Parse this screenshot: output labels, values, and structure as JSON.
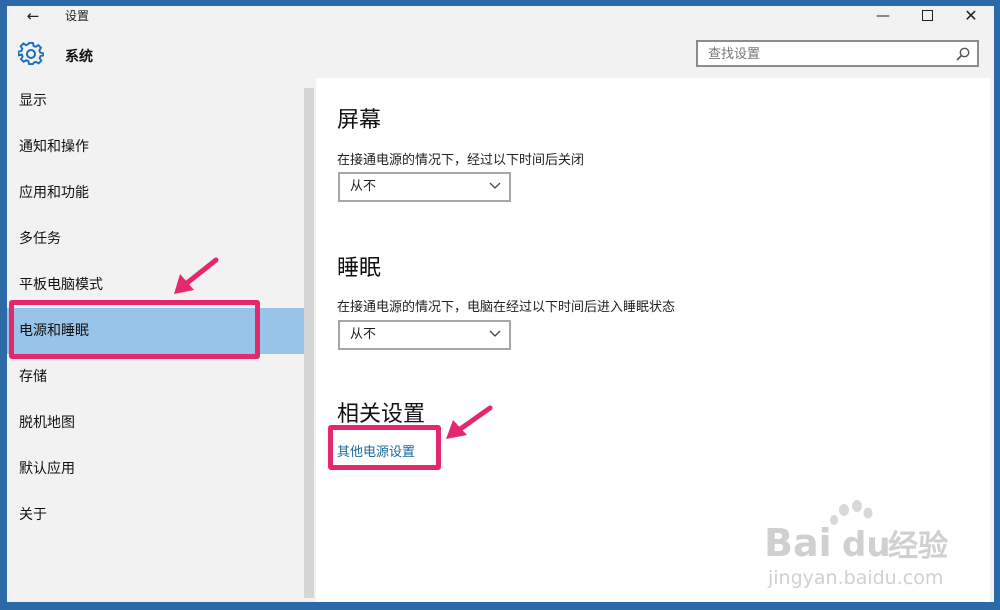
{
  "titlebar": {
    "back_glyph": "←",
    "title": "设置",
    "minimize_glyph": "—",
    "close_glyph": "✕"
  },
  "header": {
    "section_title": "系统",
    "search_placeholder": "查找设置",
    "icon": "gear-icon",
    "search_icon": "search-icon"
  },
  "sidebar": {
    "items": [
      {
        "label": "显示"
      },
      {
        "label": "通知和操作"
      },
      {
        "label": "应用和功能"
      },
      {
        "label": "多任务"
      },
      {
        "label": "平板电脑模式"
      },
      {
        "label": "电源和睡眠",
        "selected": true
      },
      {
        "label": "存储"
      },
      {
        "label": "脱机地图"
      },
      {
        "label": "默认应用"
      },
      {
        "label": "关于"
      }
    ]
  },
  "content": {
    "screen": {
      "heading": "屏幕",
      "description": "在接通电源的情况下，经过以下时间后关闭",
      "value": "从不"
    },
    "sleep": {
      "heading": "睡眠",
      "description": "在接通电源的情况下，电脑在经过以下时间后进入睡眠状态",
      "value": "从不"
    },
    "related": {
      "heading": "相关设置",
      "link": "其他电源设置"
    }
  },
  "watermark": {
    "brand": "Bai",
    "brand2": "du",
    "cn": "经验",
    "url": "jingyan.baidu.com"
  },
  "colors": {
    "selected": "#99c4ea",
    "accent": "#1a6e9e",
    "highlight": "#e5276e"
  }
}
